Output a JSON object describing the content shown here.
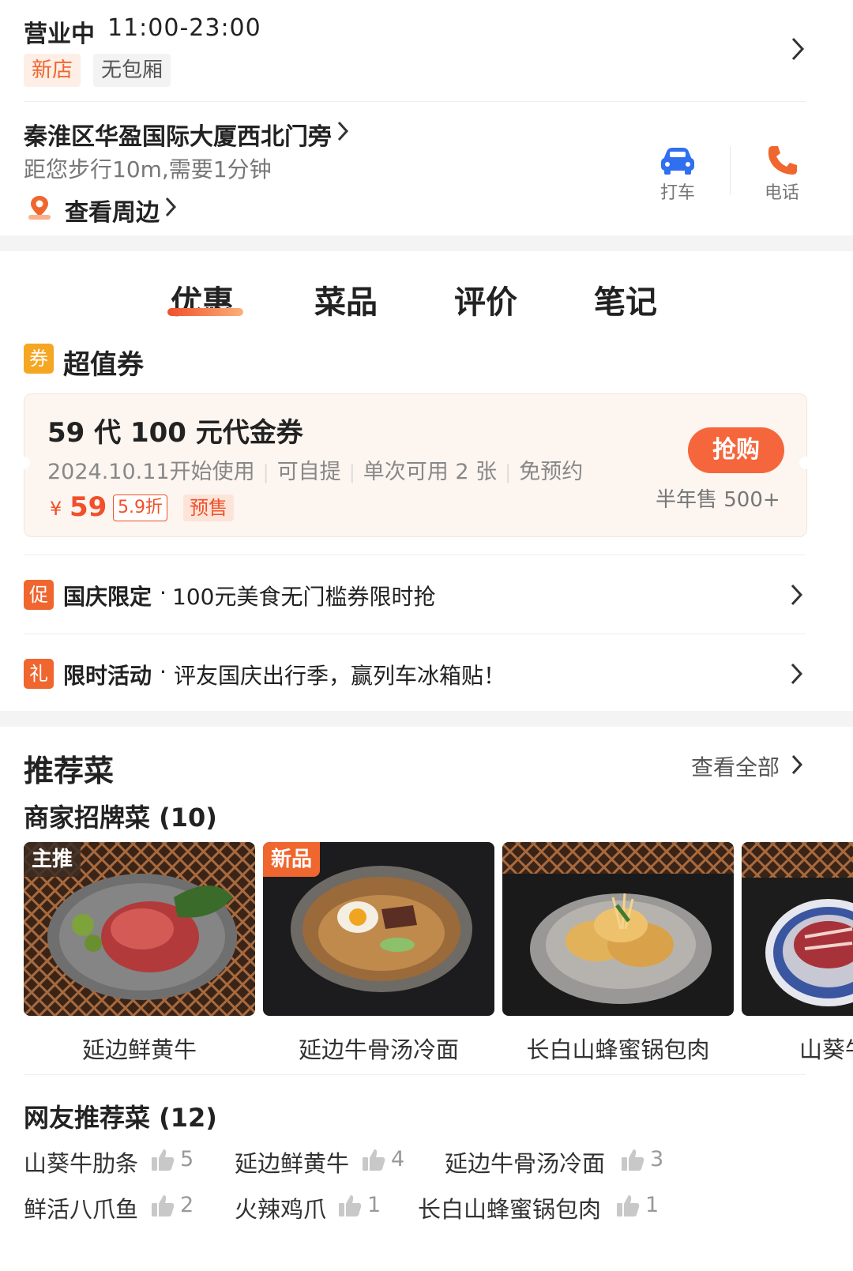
{
  "store": {
    "status": "营业中",
    "hours": "11:00-23:00",
    "tags": [
      "新店",
      "无包厢"
    ],
    "address": "秦淮区华盈国际大厦西北门旁",
    "distance": "距您步行10m,需要1分钟",
    "nearby_label": "查看周边",
    "actions": [
      {
        "label": "打车",
        "icon": "car-icon",
        "color": "#2f6ff0"
      },
      {
        "label": "电话",
        "icon": "phone-icon",
        "color": "#f0662f"
      }
    ]
  },
  "tabs": [
    "优惠",
    "菜品",
    "评价",
    "笔记"
  ],
  "active_tab": "优惠",
  "coupon_section": {
    "badge": "券",
    "title": "超值券",
    "coupon": {
      "title": "59 代 100 元代金券",
      "meta": [
        "2024.10.11开始使用",
        "可自提",
        "单次可用 2 张",
        "免预约"
      ],
      "price_symbol": "¥",
      "price": "59",
      "discount": "5.9折",
      "presale": "预售",
      "buy_label": "抢购",
      "sold": "半年售 500+"
    }
  },
  "promos": [
    {
      "badge": "促",
      "label": "国庆限定",
      "text": "100元美食无门槛券限时抢",
      "color": "#f0662f"
    },
    {
      "badge": "礼",
      "label": "限时活动",
      "text": "评友国庆出行季，赢列车冰箱贴！",
      "color": "#f0662f"
    }
  ],
  "recommend": {
    "title": "推荐菜",
    "see_all": "查看全部",
    "signature_title": "商家招牌菜 (10)",
    "dishes": [
      {
        "name": "延边鲜黄牛",
        "badge": "主推"
      },
      {
        "name": "延边牛骨汤冷面",
        "badge": "新品"
      },
      {
        "name": "长白山蜂蜜锅包肉",
        "badge": ""
      },
      {
        "name": "山葵牛肋条",
        "badge": ""
      }
    ],
    "netizen_title": "网友推荐菜 (12)",
    "netizen": [
      {
        "name": "山葵牛肋条",
        "likes": "5"
      },
      {
        "name": "延边鲜黄牛",
        "likes": "4"
      },
      {
        "name": "延边牛骨汤冷面",
        "likes": "3"
      },
      {
        "name": "鲜活八爪鱼",
        "likes": "2"
      },
      {
        "name": "火辣鸡爪",
        "likes": "1"
      },
      {
        "name": "长白山蜂蜜锅包肉",
        "likes": "1"
      }
    ]
  },
  "colors": {
    "accent": "#f0502a",
    "badge_orange": "#f5a623",
    "badge_red": "#f0662f"
  }
}
